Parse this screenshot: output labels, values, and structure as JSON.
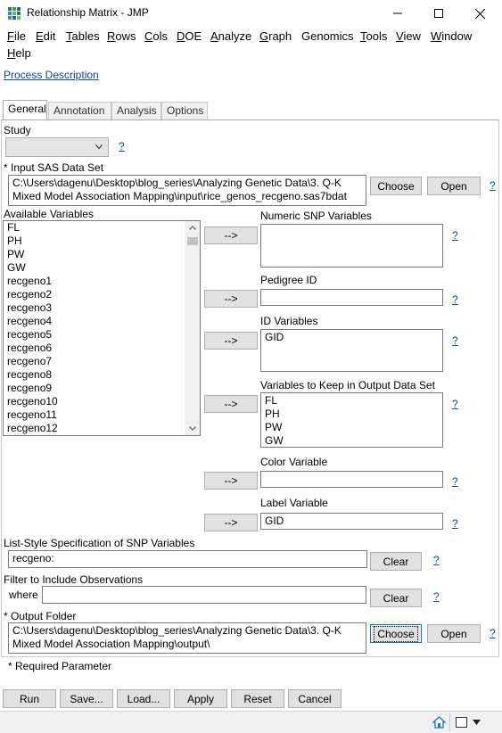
{
  "window": {
    "title": "Relationship Matrix - JMP"
  },
  "menu": [
    {
      "label": "File",
      "key": "F",
      "rest": "ile"
    },
    {
      "label": "Edit",
      "key": "E",
      "rest": "dit"
    },
    {
      "label": "Tables",
      "key": "T",
      "rest": "ables"
    },
    {
      "label": "Rows",
      "key": "R",
      "rest": "ows"
    },
    {
      "label": "Cols",
      "key": "C",
      "rest": "ols"
    },
    {
      "label": "DOE",
      "key": "D",
      "rest": "OE"
    },
    {
      "label": "Analyze",
      "key": "A",
      "rest": "nalyze"
    },
    {
      "label": "Graph",
      "key": "G",
      "rest": "raph"
    },
    {
      "label": "Genomics",
      "key": "",
      "rest": "Genomics"
    },
    {
      "label": "Tools",
      "key": "T",
      "rest": "ools"
    },
    {
      "label": "View",
      "key": "V",
      "rest": "iew"
    },
    {
      "label": "Window",
      "key": "W",
      "rest": "indow"
    },
    {
      "label": "Help",
      "key": "H",
      "rest": "elp"
    }
  ],
  "process_description": "Process Description",
  "tabs": [
    "General",
    "Annotation",
    "Analysis",
    "Options"
  ],
  "active_tab": "General",
  "study": {
    "label": "Study",
    "value": "",
    "help": "?"
  },
  "input_data": {
    "label": "* Input SAS Data Set",
    "line1": "C:\\Users\\dagenu\\Desktop\\blog_series\\Analyzing Genetic Data\\3. Q-K",
    "line2": "Mixed Model Association Mapping\\input\\rice_genos_recgeno.sas7bdat",
    "choose": "Choose",
    "open": "Open",
    "help": "?"
  },
  "available_variables": {
    "label": "Available Variables",
    "items": [
      "FL",
      "PH",
      "PW",
      "GW",
      "recgeno1",
      "recgeno2",
      "recgeno3",
      "recgeno4",
      "recgeno5",
      "recgeno6",
      "recgeno7",
      "recgeno8",
      "recgeno9",
      "recgeno10",
      "recgeno11",
      "recgeno12"
    ]
  },
  "arrow_label": "-->",
  "numeric_snp": {
    "label": "Numeric SNP Variables",
    "items": [],
    "help": "?"
  },
  "pedigree_id": {
    "label": "Pedigree ID",
    "value": "",
    "help": "?"
  },
  "id_variables": {
    "label": "ID Variables",
    "items": [
      "GID"
    ],
    "help": "?"
  },
  "keep_variables": {
    "label": "Variables to Keep in Output Data Set",
    "items": [
      "FL",
      "PH",
      "PW",
      "GW"
    ],
    "help": "?"
  },
  "color_variable": {
    "label": "Color Variable",
    "value": "",
    "help": "?"
  },
  "label_variable": {
    "label": "Label Variable",
    "value": "GID",
    "help": "?"
  },
  "list_style": {
    "label": "List-Style Specification of SNP Variables",
    "value": "recgeno:",
    "clear": "Clear",
    "help": "?"
  },
  "filter": {
    "label": "Filter to Include Observations",
    "where": "where",
    "value": "",
    "clear": "Clear",
    "help": "?"
  },
  "output_folder": {
    "label": "* Output Folder",
    "line1": "C:\\Users\\dagenu\\Desktop\\blog_series\\Analyzing Genetic Data\\3. Q-K",
    "line2": "Mixed Model Association Mapping\\output\\",
    "choose": "Choose",
    "open": "Open",
    "help": "?"
  },
  "required_note": "* Required Parameter",
  "bottom_buttons": [
    "Run",
    "Save...",
    "Load...",
    "Apply",
    "Reset",
    "Cancel"
  ],
  "colors": {
    "link": "#0645ad",
    "focus_border": "#0078d7",
    "button_face": "#e1e1e1",
    "statusbar": "#f0f0f0"
  },
  "icons": [
    "jmp-app-icon",
    "minimize-icon",
    "maximize-icon",
    "close-icon",
    "home-icon",
    "window-layout-icon",
    "dropdown-arrow-icon",
    "chevron-down-icon",
    "scroll-up-icon",
    "scroll-down-icon"
  ]
}
